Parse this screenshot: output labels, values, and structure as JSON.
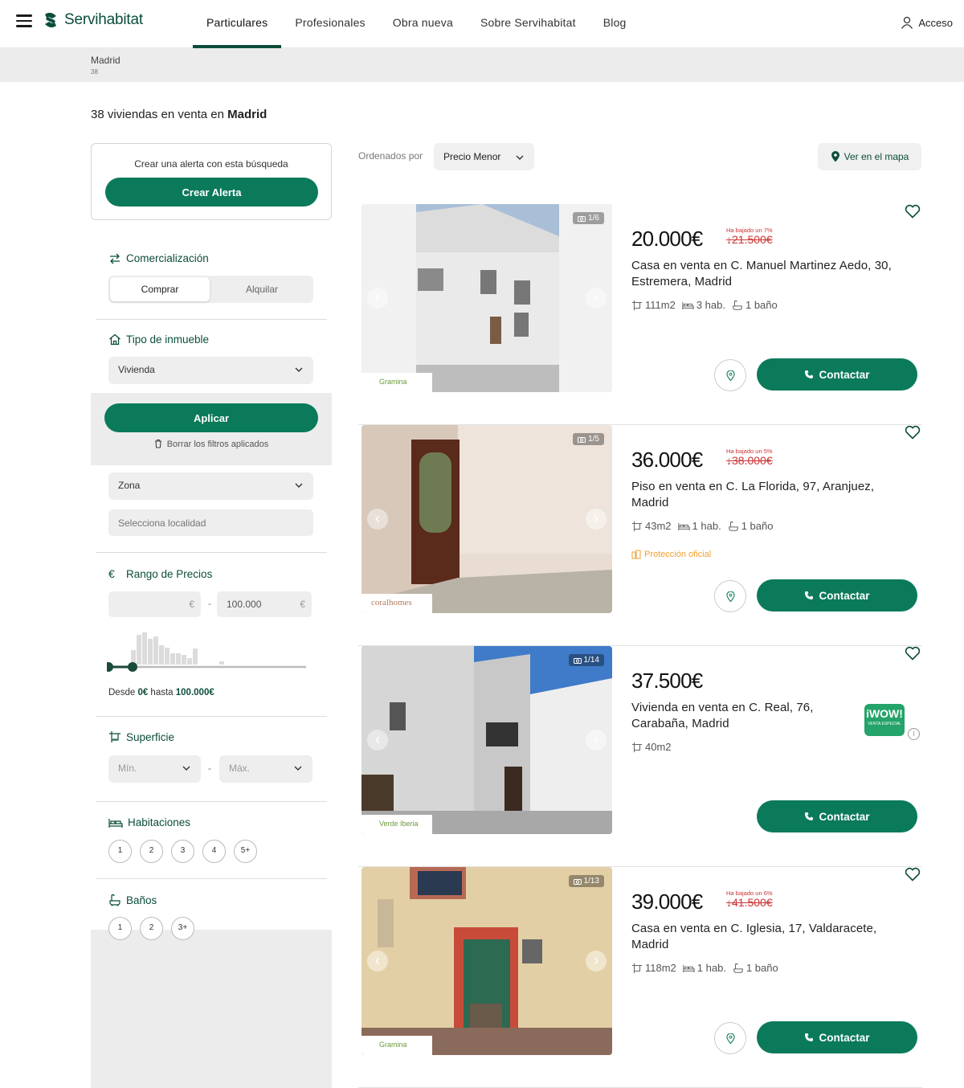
{
  "header": {
    "brand": "Servihabitat",
    "nav": [
      "Particulares",
      "Profesionales",
      "Obra nueva",
      "Sobre Servihabitat",
      "Blog"
    ],
    "login": "Acceso"
  },
  "breadcrumb": {
    "title": "Madrid",
    "count": "38"
  },
  "results": {
    "prefix": "38 viviendas en venta en ",
    "location": "Madrid"
  },
  "alert": {
    "text": "Crear una alerta con esta búsqueda",
    "button": "Crear Alerta"
  },
  "filters": {
    "commercialization": {
      "title": "Comercialización",
      "buy": "Comprar",
      "rent": "Alquilar"
    },
    "property_type": {
      "title": "Tipo de inmueble",
      "value": "Vivienda"
    },
    "apply": "Aplicar",
    "clear": "Borrar los filtros aplicados",
    "zone": {
      "select": "Zona",
      "placeholder": "Selecciona localidad"
    },
    "price": {
      "title": "Rango de Precios",
      "currency": "€",
      "min": "",
      "max": "100.000",
      "sep": "-",
      "summary_prefix": "Desde ",
      "summary_from": "0€",
      "summary_mid": " hasta ",
      "summary_to": "100.000€"
    },
    "surface": {
      "title": "Superficie",
      "min": "Mín.",
      "max": "Máx.",
      "sep": "-"
    },
    "rooms": {
      "title": "Habitaciones",
      "options": [
        "1",
        "2",
        "3",
        "4",
        "5+"
      ]
    },
    "baths": {
      "title": "Baños",
      "options": [
        "1",
        "2",
        "3+"
      ]
    }
  },
  "sort": {
    "label": "Ordenados por",
    "value": "Precio Menor",
    "map": "Ver en el mapa"
  },
  "listings": [
    {
      "counter": "1/6",
      "price": "20.000€",
      "drop_label": "Ha bajado un 7%",
      "old_price": "↓21.500€",
      "title": "Casa en venta en C. Manuel Martinez Aedo, 30, Estremera, Madrid",
      "area": "111m2",
      "rooms": "3 hab.",
      "baths": "1 baño",
      "agency": "Gramina"
    },
    {
      "counter": "1/5",
      "price": "36.000€",
      "drop_label": "Ha bajado un 5%",
      "old_price": "↓38.000€",
      "title": "Piso en venta en C. La Florida, 97, Aranjuez, Madrid",
      "area": "43m2",
      "rooms": "1 hab.",
      "baths": "1 baño",
      "agency": "coralhomes",
      "protection": "Protección oficial"
    },
    {
      "counter": "1/14",
      "price": "37.500€",
      "title": "Vivienda en venta en C. Real, 76, Carabaña, Madrid",
      "area": "40m2",
      "agency": "Verde Iberia",
      "badge": "iWOW!",
      "badge_sub": "VENTA ESPECIAL",
      "info": "i"
    },
    {
      "counter": "1/13",
      "price": "39.000€",
      "drop_label": "Ha bajado un 6%",
      "old_price": "↓41.500€",
      "title": "Casa en venta en C. Iglesia, 17, Valdaracete, Madrid",
      "area": "118m2",
      "rooms": "1 hab.",
      "baths": "1 baño",
      "agency": "Gramina"
    }
  ],
  "contact_label": "Contactar",
  "colors": {
    "brand": "#0b4d3b",
    "button": "#0b7a5a",
    "price_drop": "#cc3333"
  },
  "icons": [
    "menu-icon",
    "user-icon",
    "swap-icon",
    "house-icon",
    "chevron-down-icon",
    "trash-icon",
    "euro-icon",
    "surface-icon",
    "bed-icon",
    "bath-icon",
    "map-pin-icon",
    "camera-icon",
    "heart-icon",
    "phone-icon",
    "shield-building-icon"
  ]
}
